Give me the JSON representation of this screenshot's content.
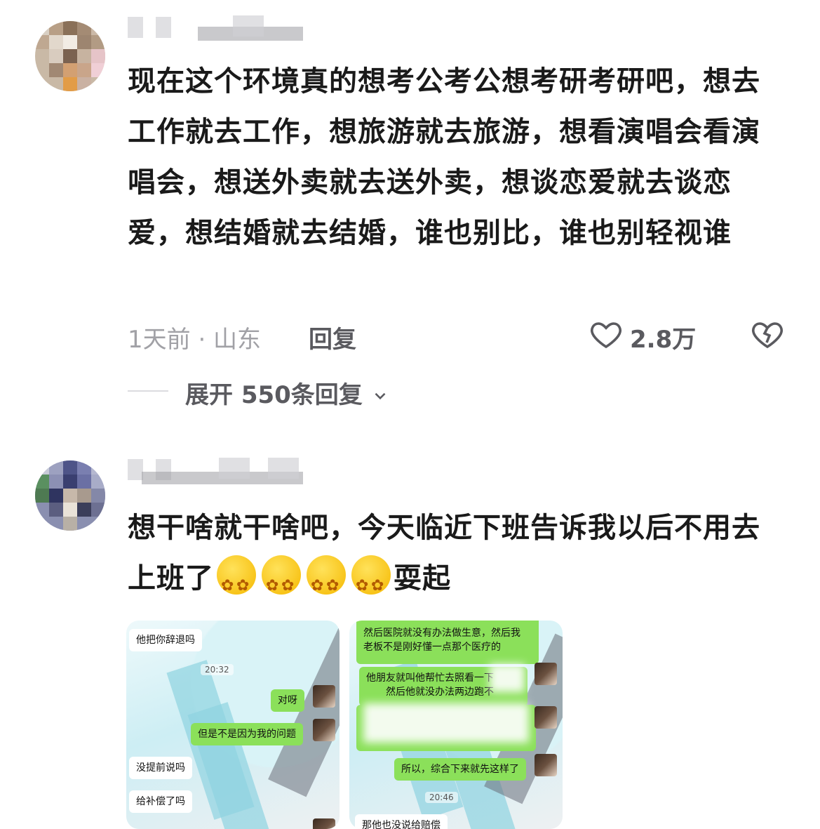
{
  "comments": [
    {
      "text": "现在这个环境真的想考公考公想考研考研吧，想去工作就去工作，想旅游就去旅游，想看演唱会看演唱会，想送外卖就去送外卖，想谈恋爱就去谈恋爱，想结婚就去结婚，谁也别比，谁也别轻视谁",
      "meta": "1天前 · 山东",
      "reply_label": "回复",
      "likes": "2.8万",
      "expand_label": "展开 550条回复"
    },
    {
      "text_main": "想干啥就干啥吧，今天临近下班告诉我以后不用去上班了",
      "text_tail": "耍起"
    }
  ],
  "screenshot1": {
    "bubbles": [
      "他把你辞退吗",
      "对呀",
      "但是不是因为我的问题",
      "没提前说吗",
      "给补偿了吗"
    ],
    "time": "20:32"
  },
  "screenshot2": {
    "bubbles": [
      "然后医院就没有办法做生意，然后我",
      "老板不是刚好懂一点那个医疗的",
      "他朋友就叫他帮忙去照看一下",
      "然后他就没办法两边跑不",
      "所以，综合下来就先这样了",
      "那他也没说给赔偿"
    ],
    "time": "20:46"
  },
  "colors": {
    "text": "#1a1a1a",
    "meta": "#a1a1a6",
    "bubble_green": "#8be05a"
  }
}
